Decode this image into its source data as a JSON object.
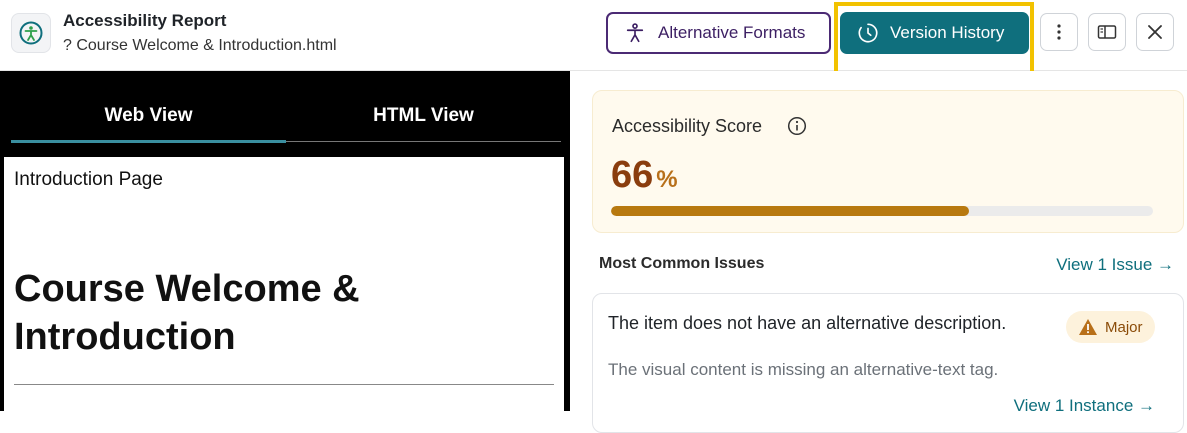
{
  "header": {
    "title": "Accessibility Report",
    "subtitle": "? Course Welcome & Introduction.html",
    "alt_formats_label": "Alternative Formats",
    "version_history_label": "Version History",
    "icons": [
      "accessibility-icon",
      "figure-icon",
      "clock-icon",
      "more-vertical-icon",
      "panel-icon",
      "close-icon"
    ]
  },
  "left_pane": {
    "tabs": [
      "Web View",
      "HTML View"
    ],
    "active_tab": "Web View",
    "doc": {
      "intro": "Introduction Page",
      "heading": "Course Welcome & Introduction"
    }
  },
  "score": {
    "label": "Accessibility Score",
    "value": "66",
    "unit": "%",
    "progress_percent": 66
  },
  "issues": {
    "title": "Most Common Issues",
    "view_link": "View 1 Issue →",
    "items": [
      {
        "title": "The item does not have an alternative description.",
        "severity": "Major",
        "description": "The visual content is missing an alternative-text tag.",
        "instance_link": "View 1 Instance →"
      }
    ]
  },
  "colors": {
    "accent": "#0f6f7d",
    "purple": "#4b2a74",
    "highlight": "#f2c200",
    "score_text": "#8a3d0e",
    "progress": "#b8790f"
  }
}
